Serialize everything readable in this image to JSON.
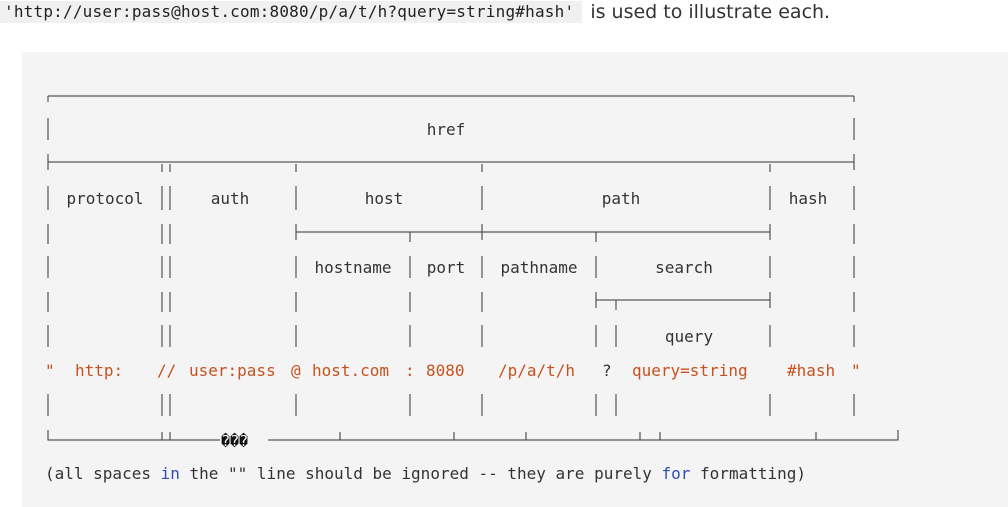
{
  "intro": {
    "example_url": "'http://user:pass@host.com:8080/p/a/t/h?query=string#hash'",
    "text": "is used to illustrate each."
  },
  "diagram": {
    "labels": {
      "href": "href",
      "protocol": "protocol",
      "auth": "auth",
      "host": "host",
      "path": "path",
      "hash": "hash",
      "hostname": "hostname",
      "port": "port",
      "pathname": "pathname",
      "search": "search",
      "query": "query"
    },
    "values": {
      "open_quote": "\"",
      "protocol": "http:",
      "slashes": "//",
      "auth": "user:pass",
      "at": "@",
      "hostname": "host.com",
      "colon": ":",
      "port": "8080",
      "pathname": "/p/a/t/h",
      "question": "?",
      "query": "query=string",
      "hash": "#hash",
      "close_quote": "\""
    },
    "garbled_glyphs": "���",
    "note": {
      "before_in": "(all spaces ",
      "in": "in",
      "middle": " the \"\" line should be ignored -- they are purely ",
      "for": "for",
      "after": " formatting)"
    }
  }
}
